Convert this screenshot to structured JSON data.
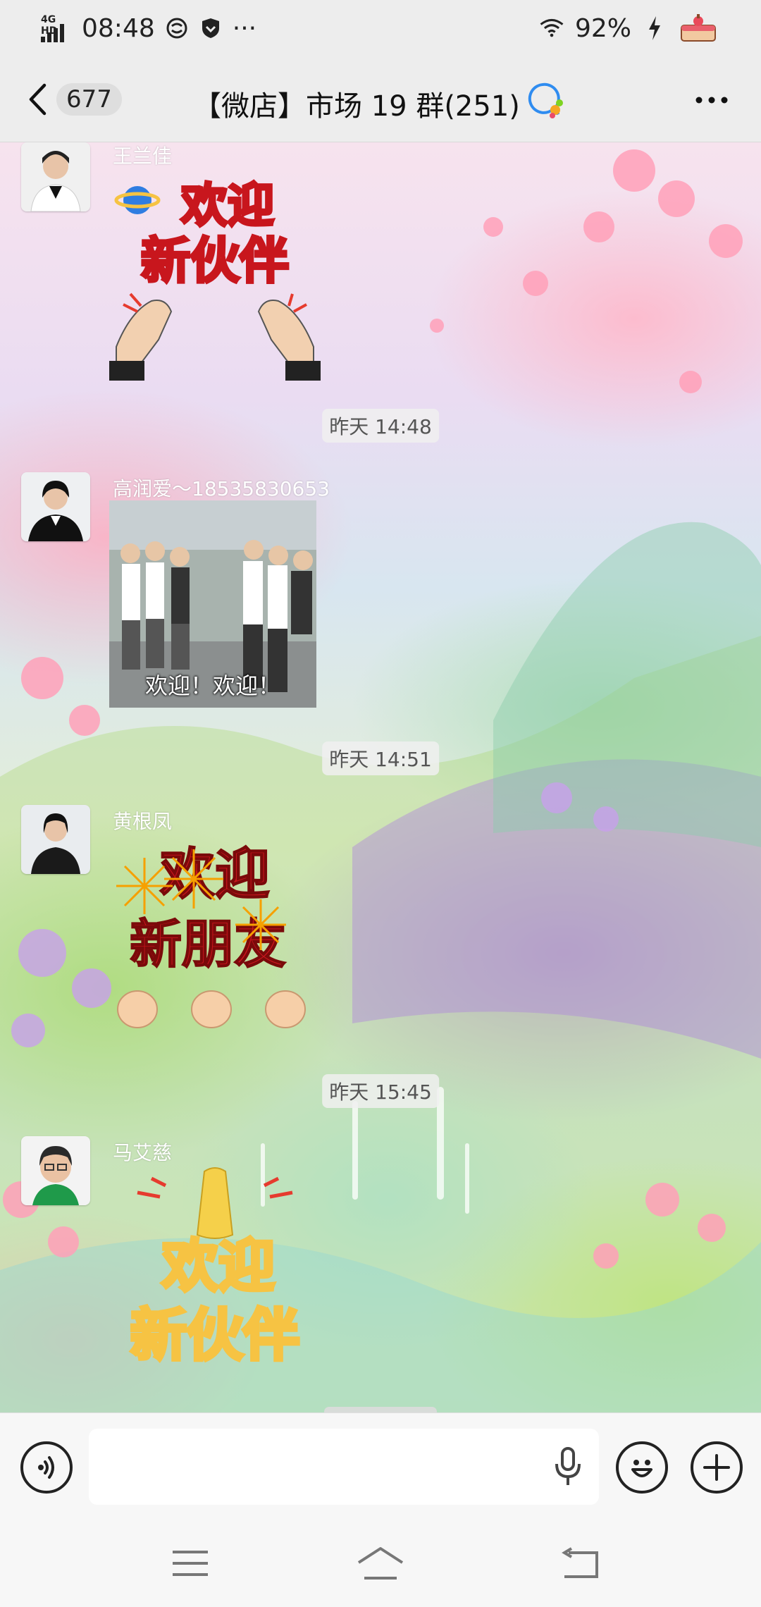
{
  "status_bar": {
    "network": "4G HD",
    "time": "08:48",
    "more": "···",
    "battery": "92%"
  },
  "header": {
    "unread_count": "677",
    "title": "【微店】市场 19 群(251)"
  },
  "messages": [
    {
      "type": "sticker",
      "sender": "王兰佳",
      "sticker_text_1": "欢迎",
      "sticker_text_2": "新伙伴"
    },
    {
      "type": "timestamp",
      "text": "昨天 14:48"
    },
    {
      "type": "image",
      "sender": "高润爱～18535830653",
      "caption": "欢迎！欢迎！"
    },
    {
      "type": "timestamp",
      "text": "昨天 14:51"
    },
    {
      "type": "sticker",
      "sender": "黄根凤",
      "sticker_text_1": "欢迎",
      "sticker_text_2": "新朋友"
    },
    {
      "type": "timestamp",
      "text": "昨天 15:45"
    },
    {
      "type": "sticker",
      "sender": "马艾慈",
      "sticker_text_1": "欢迎",
      "sticker_text_2": "新伙伴"
    }
  ],
  "input_bar": {
    "placeholder": ""
  },
  "colors": {
    "bar_bg": "#ededed",
    "sticker_red": "#c8161d",
    "sticker_gold": "#f6c343"
  }
}
